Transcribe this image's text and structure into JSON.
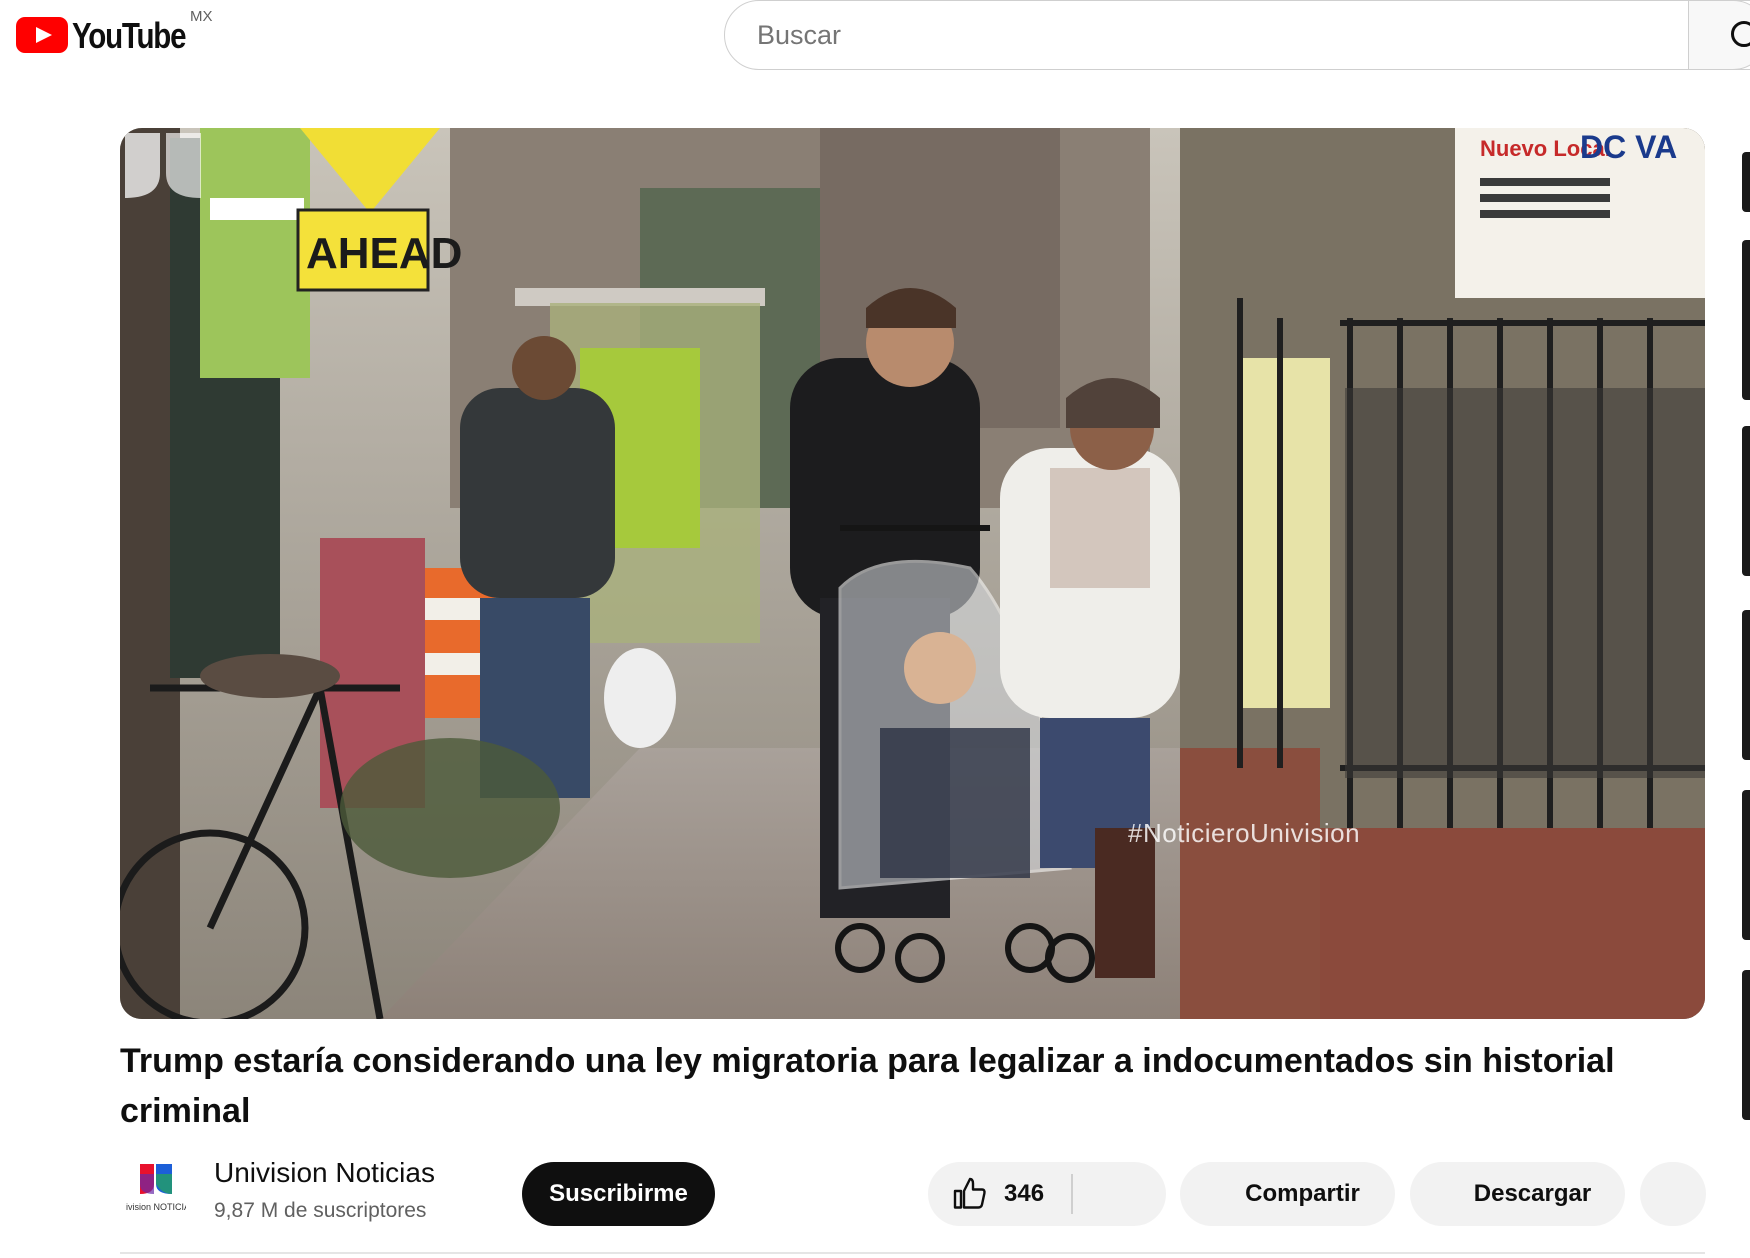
{
  "header": {
    "logo_text": "YouTube",
    "country_code": "MX",
    "search_placeholder": "Buscar"
  },
  "player": {
    "watermark": "#NoticieroUnivision",
    "scene_signs": {
      "ahead": "AHEAD",
      "nuevo_local": "Nuevo Local",
      "dc_va": "DC VA"
    }
  },
  "video": {
    "title": "Trump estaría considerando una ley migratoria para legalizar a indocumentados sin historial criminal"
  },
  "owner": {
    "channel_name": "Univision Noticias",
    "subscribers": "9,87 M de suscriptores",
    "avatar_caption": "univision NOTICIAS",
    "subscribe_label": "Suscribirme"
  },
  "actions": {
    "like_count": "346",
    "share_label": "Compartir",
    "download_label": "Descargar"
  },
  "colors": {
    "brand_red": "#ff0000",
    "text_primary": "#0f0f0f",
    "text_secondary": "#606060",
    "pill_bg": "#f2f2f2",
    "subscribe_bg": "#0f0f0f"
  }
}
